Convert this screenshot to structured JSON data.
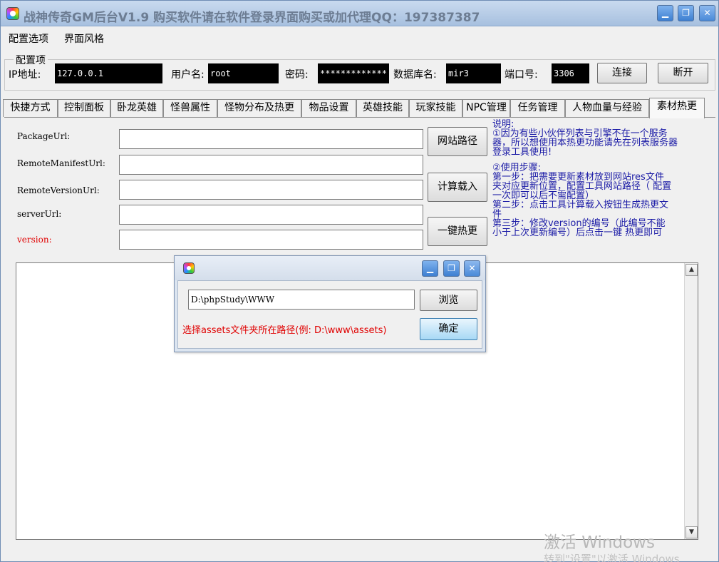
{
  "window": {
    "title": "战神传奇GM后台V1.9   购买软件请在软件登录界面购买或加代理QQ：197387387"
  },
  "menubar": {
    "items": [
      "配置选项",
      "界面风格"
    ]
  },
  "config": {
    "legend": "配置项",
    "ip_label": "IP地址:",
    "ip_value": "127.0.0.1",
    "user_label": "用户名:",
    "user_value": "root",
    "password_label": "密码:",
    "password_value": "*************",
    "db_label": "数据库名:",
    "db_value": "mir3",
    "port_label": "端口号:",
    "port_value": "3306",
    "connect_label": "连接",
    "disconnect_label": "断开"
  },
  "tabs": [
    {
      "label": "快捷方式",
      "active": false
    },
    {
      "label": "控制面板",
      "active": false
    },
    {
      "label": "卧龙英雄",
      "active": false
    },
    {
      "label": "怪兽属性",
      "active": false
    },
    {
      "label": "怪物分布及热更",
      "active": false
    },
    {
      "label": "物品设置",
      "active": false
    },
    {
      "label": "英雄技能",
      "active": false
    },
    {
      "label": "玩家技能",
      "active": false
    },
    {
      "label": "NPC管理",
      "active": false
    },
    {
      "label": "任务管理",
      "active": false
    },
    {
      "label": "人物血量与经验",
      "active": false
    },
    {
      "label": "素材热更",
      "active": true
    }
  ],
  "hotupdate": {
    "fields": [
      {
        "label": "PackageUrl:",
        "value": "",
        "highlight": false
      },
      {
        "label": "RemoteManifestUrl:",
        "value": "",
        "highlight": false
      },
      {
        "label": "RemoteVersionUrl:",
        "value": "",
        "highlight": false
      },
      {
        "label": "serverUrl:",
        "value": "",
        "highlight": false
      },
      {
        "label": "version:",
        "value": "",
        "highlight": true
      }
    ],
    "buttons": {
      "site_path": "网站路径",
      "calc_load": "计算载入",
      "one_click": "一键热更"
    },
    "help_lines": [
      "说明:",
      "①因为有些小伙伴列表与引擎不在一个服务",
      "器，所以想使用本热更功能请先在列表服务器",
      "登录工具使用!",
      "",
      "②使用步骤:",
      "   第一步：把需要更新素材放到网站res文件",
      "夹对应更新位置，配置工具网站路径（  配置",
      "一次即可以后不需配置）",
      "   第二步：点击工具计算载入按钮生成热更文",
      "件",
      "   第三步：修改version的编号（此编号不能",
      "小于上次更新编号）后点击一键  热更即可"
    ],
    "log_text": ""
  },
  "dialog": {
    "path_value": "D:\\phpStudy\\WWW",
    "browse_label": "浏览",
    "ok_label": "确定",
    "hint": "选择assets文件夹所在路径(例: D:\\www\\assets)"
  },
  "watermark": {
    "line1": "激活 Windows",
    "line2": "转到\"设置\"以激活 Windows"
  },
  "colors": {
    "help_text": "#1a1aa6",
    "hint_text": "#e00000",
    "dark_input_bg": "#000000"
  }
}
